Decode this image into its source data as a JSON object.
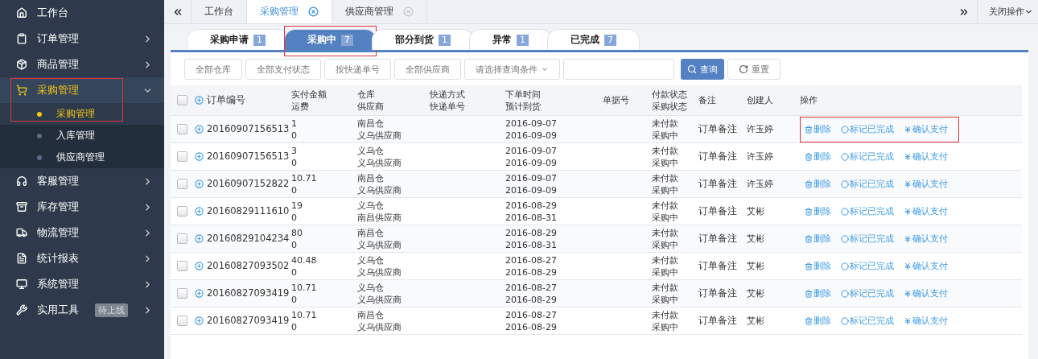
{
  "sidebar": {
    "items": [
      {
        "kind": "link",
        "label": "工作台",
        "selected": false
      },
      {
        "kind": "menu",
        "label": "订单管理",
        "expanded": false,
        "selected": false
      },
      {
        "kind": "menu",
        "label": "商品管理",
        "expanded": false,
        "selected": false
      },
      {
        "kind": "menu",
        "label": "采购管理",
        "expanded": true,
        "selected": true,
        "marked": true,
        "children": [
          {
            "label": "采购管理",
            "selected": true
          },
          {
            "label": "入库管理",
            "selected": false
          },
          {
            "label": "供应商管理",
            "selected": false
          }
        ]
      },
      {
        "kind": "menu",
        "label": "客服管理",
        "expanded": false,
        "selected": false
      },
      {
        "kind": "menu",
        "label": "库存管理",
        "expanded": false,
        "selected": false
      },
      {
        "kind": "menu",
        "label": "物流管理",
        "expanded": false,
        "selected": false
      },
      {
        "kind": "menu",
        "label": "统计报表",
        "expanded": false,
        "selected": false
      },
      {
        "kind": "menu",
        "label": "系统管理",
        "expanded": false,
        "selected": false
      },
      {
        "kind": "menu",
        "label": "实用工具",
        "expanded": false,
        "selected": false,
        "badge": "待上线"
      }
    ]
  },
  "page_tabs": {
    "items": [
      {
        "label": "工作台",
        "selected": false,
        "closable": false
      },
      {
        "label": "采购管理",
        "selected": true,
        "closable": true
      },
      {
        "label": "供应商管理",
        "selected": false,
        "closable": true
      }
    ],
    "close_menu": "关闭操作"
  },
  "status_tabs": [
    {
      "label": "采购申请",
      "count": "1",
      "selected": false
    },
    {
      "label": "采购中",
      "count": "7",
      "selected": true,
      "marked": true
    },
    {
      "label": "部分到货",
      "count": "1",
      "selected": false
    },
    {
      "label": "异常",
      "count": "1",
      "selected": false
    },
    {
      "label": "已完成",
      "count": "7",
      "selected": false
    }
  ],
  "filters": {
    "buttons": [
      "全部仓库",
      "全部支付状态",
      "按快递单号",
      "全部供应商"
    ],
    "condition_select": "请选择查询条件",
    "search_button": "查询",
    "reset_button": "重置"
  },
  "table": {
    "select_all_checked": false,
    "columns": [
      [
        "订单编号"
      ],
      [
        "实付金额",
        "运费"
      ],
      [
        "仓库",
        "供应商"
      ],
      [
        "快递方式",
        "快递单号"
      ],
      [
        "下单时间",
        "预计到货"
      ],
      [
        "单据号"
      ],
      [
        "付款状态",
        "采购状态"
      ],
      [
        "备注"
      ],
      [
        "创建人"
      ],
      [
        "操作"
      ]
    ],
    "rows": [
      {
        "checked": false,
        "marked": true,
        "order_no": "20160907156513",
        "amount": "1",
        "freight": "0",
        "warehouse": "南昌仓",
        "supplier": "义乌供应商",
        "ordered": "2016-09-07",
        "eta": "2016-09-09",
        "pay_status": "未付款",
        "purchase_status": "采购中",
        "note": "订单备注",
        "creator": "许玉婷",
        "actions": [
          "删除",
          "标记已完成",
          "确认支付"
        ]
      },
      {
        "checked": false,
        "order_no": "20160907156513",
        "amount": "3",
        "freight": "0",
        "warehouse": "义乌仓",
        "supplier": "义乌供应商",
        "ordered": "2016-09-07",
        "eta": "2016-09-09",
        "pay_status": "未付款",
        "purchase_status": "采购中",
        "note": "订单备注",
        "creator": "许玉婷",
        "actions": [
          "删除",
          "标记已完成",
          "确认支付"
        ]
      },
      {
        "checked": false,
        "order_no": "20160907152822",
        "amount": "10.71",
        "freight": "0",
        "warehouse": "南昌仓",
        "supplier": "义乌供应商",
        "ordered": "2016-09-07",
        "eta": "2016-09-09",
        "pay_status": "未付款",
        "purchase_status": "采购中",
        "note": "订单备注",
        "creator": "许玉婷",
        "actions": [
          "删除",
          "标记已完成",
          "确认支付"
        ]
      },
      {
        "checked": false,
        "order_no": "20160829111610",
        "amount": "19",
        "freight": "0",
        "warehouse": "义乌仓",
        "supplier": "南昌供应商",
        "ordered": "2016-08-29",
        "eta": "2016-08-31",
        "pay_status": "未付款",
        "purchase_status": "采购中",
        "note": "订单备注",
        "creator": "艾彬",
        "actions": [
          "删除",
          "标记已完成",
          "确认支付"
        ]
      },
      {
        "checked": false,
        "order_no": "20160829104234",
        "amount": "80",
        "freight": "0",
        "warehouse": "南昌仓",
        "supplier": "义乌供应商",
        "ordered": "2016-08-29",
        "eta": "2016-08-31",
        "pay_status": "未付款",
        "purchase_status": "采购中",
        "note": "订单备注",
        "creator": "艾彬",
        "actions": [
          "删除",
          "标记已完成",
          "确认支付"
        ]
      },
      {
        "checked": false,
        "order_no": "20160827093502",
        "amount": "40.48",
        "freight": "0",
        "warehouse": "义乌仓",
        "supplier": "义乌供应商",
        "ordered": "2016-08-27",
        "eta": "2016-08-29",
        "pay_status": "未付款",
        "purchase_status": "采购中",
        "note": "订单备注",
        "creator": "艾彬",
        "actions": [
          "删除",
          "标记已完成",
          "确认支付"
        ]
      },
      {
        "checked": false,
        "order_no": "20160827093419",
        "amount": "10.71",
        "freight": "0",
        "warehouse": "义乌仓",
        "supplier": "义乌供应商",
        "ordered": "2016-08-27",
        "eta": "2016-08-29",
        "pay_status": "未付款",
        "purchase_status": "采购中",
        "note": "订单备注",
        "creator": "艾彬",
        "actions": [
          "删除",
          "标记已完成",
          "确认支付"
        ]
      },
      {
        "checked": false,
        "order_no": "20160827093419",
        "amount": "10.71",
        "freight": "0",
        "warehouse": "南昌仓",
        "supplier": "义乌供应商",
        "ordered": "2016-08-27",
        "eta": "2016-08-29",
        "pay_status": "未付款",
        "purchase_status": "采购中",
        "note": "订单备注",
        "creator": "艾彬",
        "actions": [
          "删除",
          "标记已完成",
          "确认支付"
        ]
      }
    ]
  }
}
